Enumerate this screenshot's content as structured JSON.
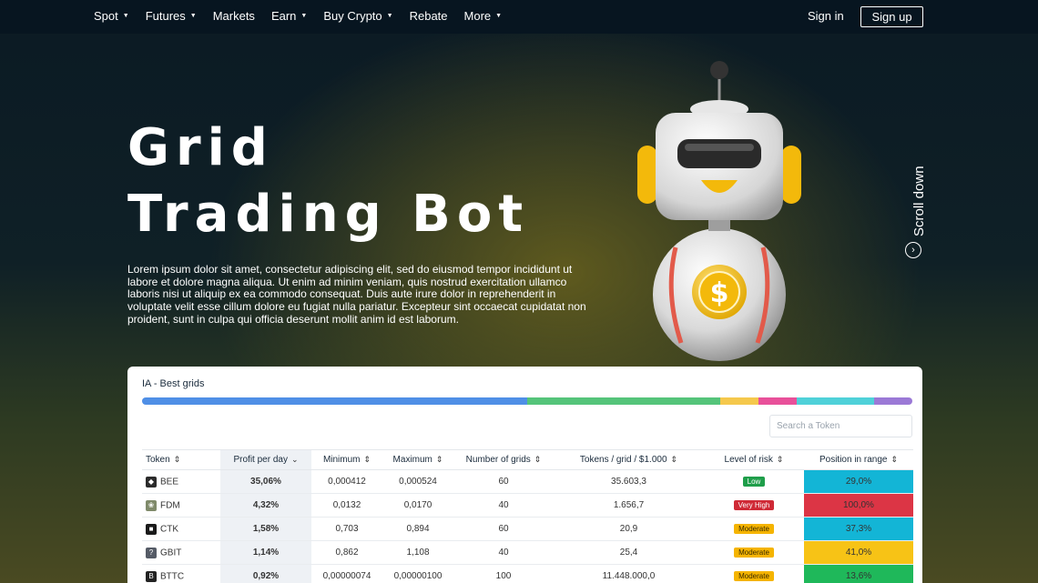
{
  "nav": {
    "items": [
      {
        "label": "Spot",
        "caret": true
      },
      {
        "label": "Futures",
        "caret": true
      },
      {
        "label": "Markets",
        "caret": false
      },
      {
        "label": "Earn",
        "caret": true
      },
      {
        "label": "Buy Crypto",
        "caret": true
      },
      {
        "label": "Rebate",
        "caret": false
      },
      {
        "label": "More",
        "caret": true
      }
    ],
    "signin": "Sign in",
    "signup": "Sign up"
  },
  "hero": {
    "title_line1": "Grid",
    "title_line2": "Trading Bot",
    "description": "Lorem ipsum dolor sit amet, consectetur adipiscing elit, sed do eiusmod tempor incididunt ut labore et dolore magna aliqua. Ut enim ad minim veniam, quis nostrud exercitation ullamco laboris nisi ut aliquip ex ea commodo consequat. Duis aute irure dolor in reprehenderit in voluptate velit esse cillum dolore eu fugiat nulla pariatur. Excepteur sint occaecat cupidatat non proident, sunt in culpa qui officia deserunt mollit anim id est laborum.",
    "scroll_label": "Scroll down"
  },
  "card": {
    "title": "IA - Best grids",
    "progress_segments": [
      {
        "fraction": 0.5,
        "color": "#4f8fe6"
      },
      {
        "fraction": 0.25,
        "color": "#55c47a"
      },
      {
        "fraction": 0.05,
        "color": "#f5c84c"
      },
      {
        "fraction": 0.05,
        "color": "#e8509a"
      },
      {
        "fraction": 0.1,
        "color": "#4fd1d9"
      },
      {
        "fraction": 0.05,
        "color": "#9b79d6"
      }
    ],
    "search_placeholder": "Search a Token",
    "columns": [
      "Token",
      "Profit per day",
      "Minimum",
      "Maximum",
      "Number of grids",
      "Tokens / grid / $1.000",
      "Level of risk",
      "Position in range"
    ],
    "rows": [
      {
        "token": "BEE",
        "icon_color": "#2b2b2b",
        "profit": "35,06%",
        "min": "0,000412",
        "max": "0,000524",
        "grids": "60",
        "tokens": "35.603,3",
        "risk": "Low",
        "risk_color": "#1f9e4a",
        "position": "29,0%",
        "pos_color": "#13b5d6"
      },
      {
        "token": "FDM",
        "icon_color": "#7f8a6a",
        "profit": "4,32%",
        "min": "0,0132",
        "max": "0,0170",
        "grids": "40",
        "tokens": "1.656,7",
        "risk": "Very High",
        "risk_color": "#cf2a36",
        "position": "100,0%",
        "pos_color": "#dc3545"
      },
      {
        "token": "CTK",
        "icon_color": "#1a1a1a",
        "profit": "1,58%",
        "min": "0,703",
        "max": "0,894",
        "grids": "60",
        "tokens": "20,9",
        "risk": "Moderate",
        "risk_color": "#f5b400",
        "position": "37,3%",
        "pos_color": "#13b5d6"
      },
      {
        "token": "GBIT",
        "icon_color": "#555b66",
        "profit": "1,14%",
        "min": "0,862",
        "max": "1,108",
        "grids": "40",
        "tokens": "25,4",
        "risk": "Moderate",
        "risk_color": "#f5b400",
        "position": "41,0%",
        "pos_color": "#f7c316"
      },
      {
        "token": "BTTC",
        "icon_color": "#222222",
        "profit": "0,92%",
        "min": "0,00000074",
        "max": "0,00000100",
        "grids": "100",
        "tokens": "11.448.000,0",
        "risk": "Moderate",
        "risk_color": "#f5b400",
        "position": "13,6%",
        "pos_color": "#1fb85a"
      }
    ]
  }
}
